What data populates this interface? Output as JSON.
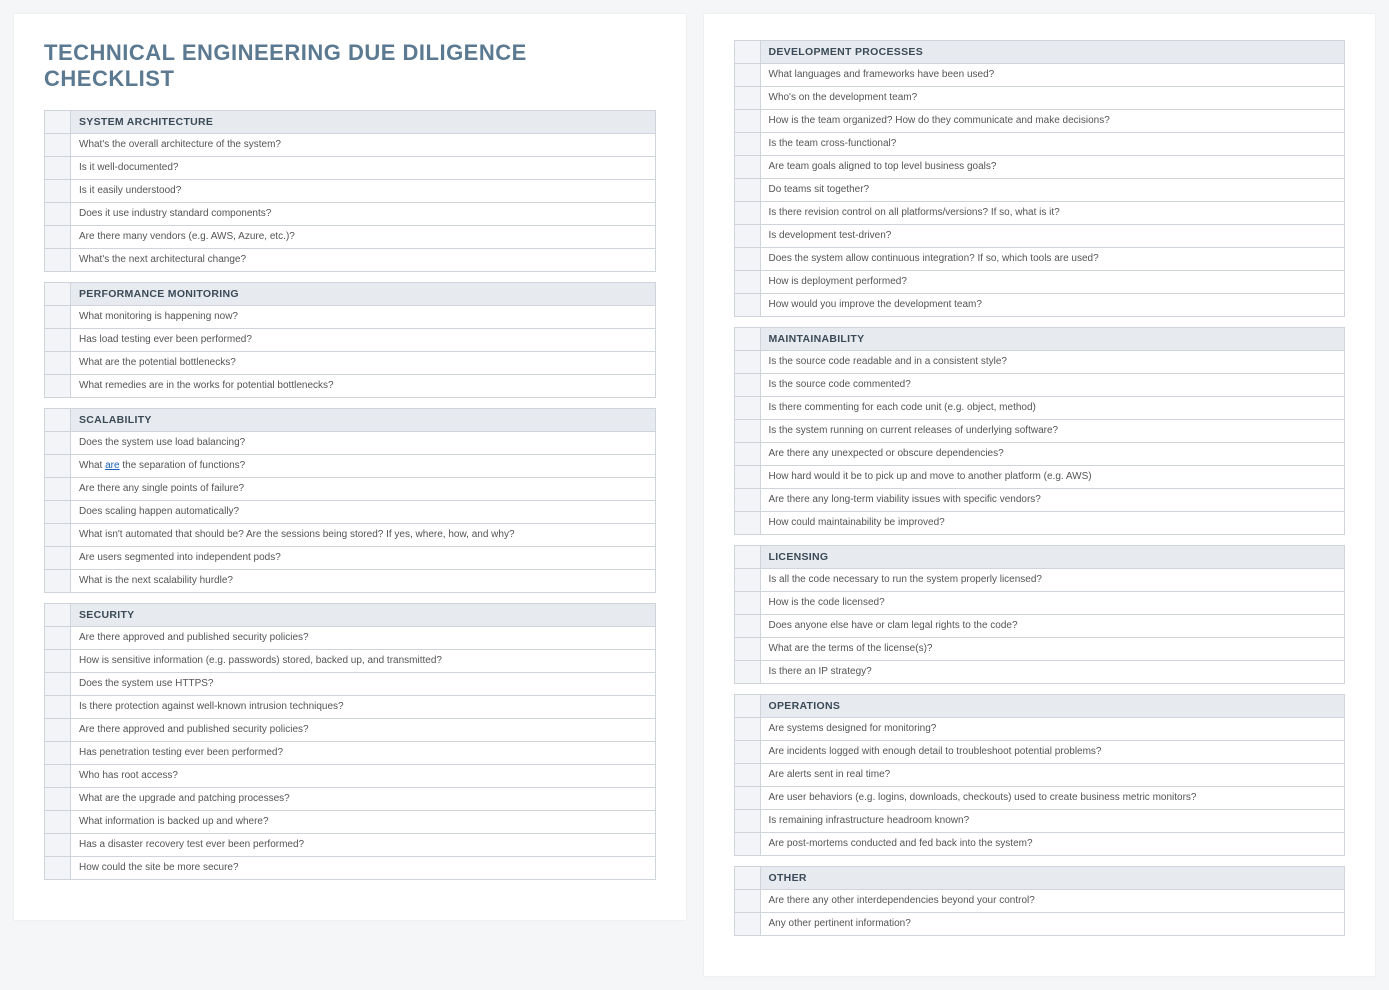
{
  "title": "TECHNICAL ENGINEERING DUE DILIGENCE CHECKLIST",
  "pages": [
    {
      "sections": [
        {
          "heading": "SYSTEM ARCHITECTURE",
          "items": [
            "What's the overall architecture of the system?",
            "Is it well-documented?",
            "Is it easily understood?",
            "Does it use industry standard components?",
            "Are there many vendors (e.g. AWS, Azure, etc.)?",
            "What's the next architectural change?"
          ]
        },
        {
          "heading": "PERFORMANCE MONITORING",
          "items": [
            "What monitoring is happening now?",
            "Has load testing ever been performed?",
            "What are the potential bottlenecks?",
            "What remedies are in the works for potential bottlenecks?"
          ]
        },
        {
          "heading": "SCALABILITY",
          "items": [
            "Does the system use load balancing?",
            "What are the separation of functions?",
            "Are there any single points of failure?",
            "Does scaling happen automatically?",
            "What isn't automated that should be? Are the sessions being stored? If yes, where, how, and why?",
            "Are users segmented into independent pods?",
            "What is the next scalability hurdle?"
          ]
        },
        {
          "heading": "SECURITY",
          "items": [
            "Are there approved and published security policies?",
            "How is sensitive information (e.g. passwords) stored, backed up, and transmitted?",
            "Does the system use HTTPS?",
            "Is there protection against well-known intrusion techniques?",
            "Are there approved and published security policies?",
            "Has penetration testing ever been performed?",
            "Who has root access?",
            "What are the upgrade and patching processes?",
            "What information is backed up and where?",
            "Has a disaster recovery test ever been performed?",
            "How could the site be more secure?"
          ]
        }
      ]
    },
    {
      "sections": [
        {
          "heading": "DEVELOPMENT PROCESSES",
          "items": [
            "What languages and frameworks have been used?",
            "Who's on the development team?",
            "How is the team organized? How do they communicate and make decisions?",
            "Is the team cross-functional?",
            "Are team goals aligned to top level business goals?",
            "Do teams sit together?",
            "Is there revision control on all platforms/versions? If so, what is it?",
            "Is development test-driven?",
            "Does the system allow continuous integration? If so, which tools are used?",
            "How is deployment performed?",
            "How would you improve the development team?"
          ]
        },
        {
          "heading": "MAINTAINABILITY",
          "items": [
            "Is the source code readable and in a consistent style?",
            "Is the source code commented?",
            "Is there commenting for each code unit (e.g. object, method)",
            "Is the system running on current releases of underlying software?",
            "Are there any unexpected or obscure dependencies?",
            "How hard would it be to pick up and move to another platform (e.g. AWS)",
            "Are there any long-term viability issues with specific vendors?",
            "How could maintainability be improved?"
          ]
        },
        {
          "heading": "LICENSING",
          "items": [
            "Is all the code necessary to run the system properly licensed?",
            "How is the code licensed?",
            "Does anyone else have or clam legal rights to the code?",
            "What are the terms of the license(s)?",
            "Is there an IP strategy?"
          ]
        },
        {
          "heading": "OPERATIONS",
          "items": [
            "Are systems designed for monitoring?",
            "Are incidents logged with enough detail to troubleshoot potential problems?",
            "Are alerts sent in real time?",
            "Are user behaviors (e.g. logins, downloads, checkouts) used to create business metric monitors?",
            "Is remaining infrastructure headroom known?",
            "Are post-mortems conducted and fed back into the system?"
          ]
        },
        {
          "heading": "OTHER",
          "items": [
            "Are there any other interdependencies beyond your control?",
            "Any other pertinent information?"
          ]
        }
      ]
    }
  ],
  "special": {
    "scalability_are_index": 1,
    "scalability_are_word": "are"
  }
}
